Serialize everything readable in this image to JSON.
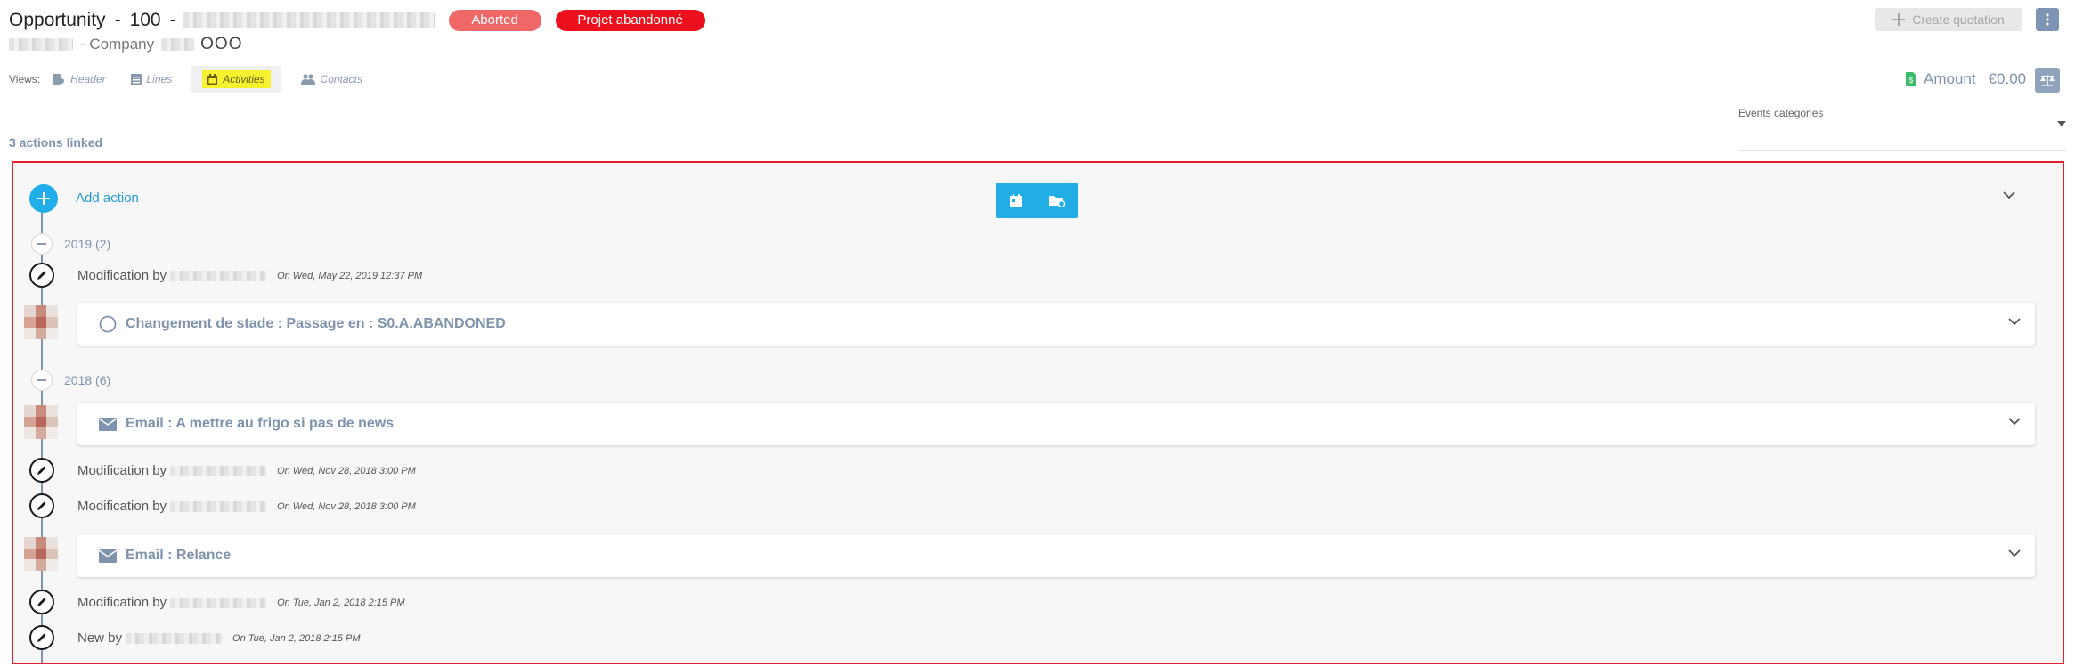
{
  "header": {
    "object_type": "Opportunity",
    "ref_number": "100",
    "title_sep": "-",
    "badge_aborted": "Aborted",
    "badge_projet": "Projet abandonné",
    "subtitle_company": "- Company",
    "subtitle_suffix": "OOO",
    "colors": {
      "aborted": "#f06767",
      "projet": "#ec0f1c",
      "accent": "#1faee9",
      "muted": "#7f93ad"
    }
  },
  "toolbar": {
    "create_quotation": "Create quotation",
    "more_icon": "vertical-ellipsis-icon"
  },
  "views": {
    "label": "Views:",
    "tabs": [
      {
        "label": "Header",
        "icon": "header-icon"
      },
      {
        "label": "Lines",
        "icon": "list-icon"
      },
      {
        "label": "Activities",
        "icon": "calendar-icon"
      },
      {
        "label": "Contacts",
        "icon": "users-icon"
      }
    ]
  },
  "amount": {
    "label": "Amount",
    "value": "€0.00"
  },
  "actions_linked": "3 actions linked",
  "filters": {
    "events_categories": "Events categories"
  },
  "timeline": {
    "add_action": "Add action",
    "groups": [
      {
        "year_label": "2019 (2)"
      },
      {
        "year_label": "2018 (6)"
      }
    ],
    "entries": [
      {
        "type": "modification",
        "text": "Modification by",
        "date": "On Wed, May 22, 2019 12:37 PM"
      },
      {
        "type": "card",
        "title": "Changement de stade : Passage en : S0.A.ABANDONED",
        "icon": "circle-icon"
      },
      {
        "type": "card",
        "title": "Email : A mettre au frigo si pas de news",
        "icon": "envelope-icon"
      },
      {
        "type": "modification",
        "text": "Modification by",
        "date": "On Wed, Nov 28, 2018 3:00 PM"
      },
      {
        "type": "modification",
        "text": "Modification by",
        "date": "On Wed, Nov 28, 2018 3:00 PM"
      },
      {
        "type": "card",
        "title": "Email : Relance",
        "icon": "envelope-icon"
      },
      {
        "type": "modification",
        "text": "Modification by",
        "date": "On Tue, Jan 2, 2018 2:15 PM"
      },
      {
        "type": "modification",
        "text": "New by",
        "date": "On Tue, Jan 2, 2018 2:15 PM"
      }
    ]
  }
}
